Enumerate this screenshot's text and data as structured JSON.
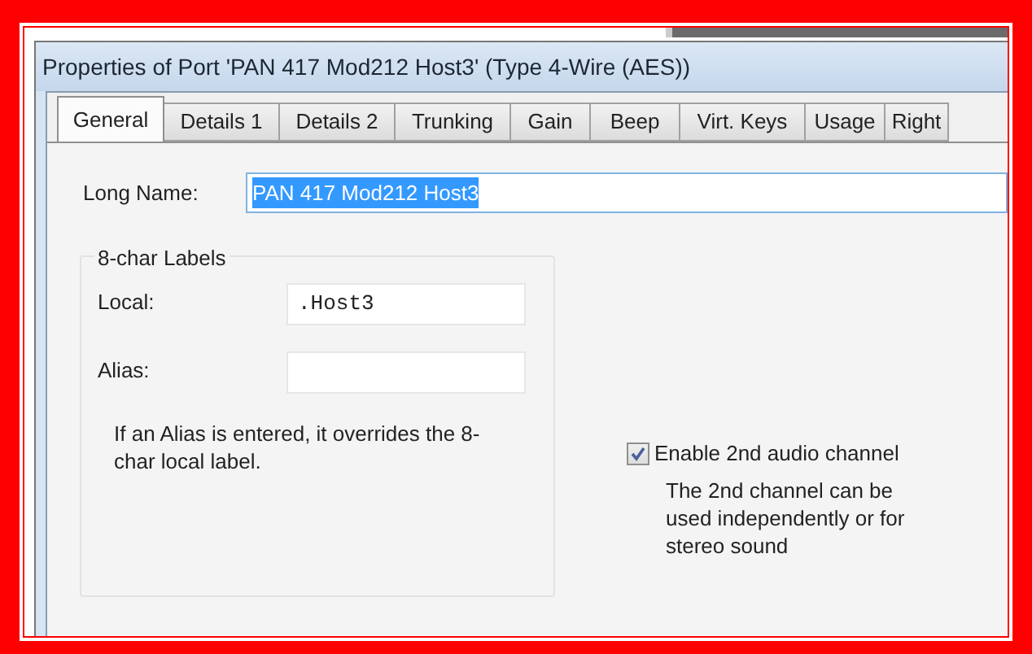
{
  "window": {
    "title": "Properties of Port 'PAN 417 Mod212 Host3' (Type 4-Wire (AES))"
  },
  "tabs": [
    {
      "label": "General",
      "selected": true
    },
    {
      "label": "Details 1",
      "selected": false
    },
    {
      "label": "Details 2",
      "selected": false
    },
    {
      "label": "Trunking",
      "selected": false
    },
    {
      "label": "Gain",
      "selected": false
    },
    {
      "label": "Beep",
      "selected": false
    },
    {
      "label": "Virt. Keys",
      "selected": false
    },
    {
      "label": "Usage",
      "selected": false
    },
    {
      "label": "Right",
      "selected": false
    }
  ],
  "long_name": {
    "label": "Long Name:",
    "value": "PAN 417 Mod212 Host3",
    "selected": true
  },
  "labels_group": {
    "title": "8-char Labels",
    "fields": [
      {
        "label": "Local:",
        "value": ".Host3"
      },
      {
        "label": "Alias:"
      }
    ],
    "note": "If an Alias is entered, it overrides the 8-char local label."
  },
  "second_channel": {
    "label": "Enable 2nd audio channel",
    "checked": true,
    "description": "The 2nd channel can be used independently or for stereo sound"
  }
}
